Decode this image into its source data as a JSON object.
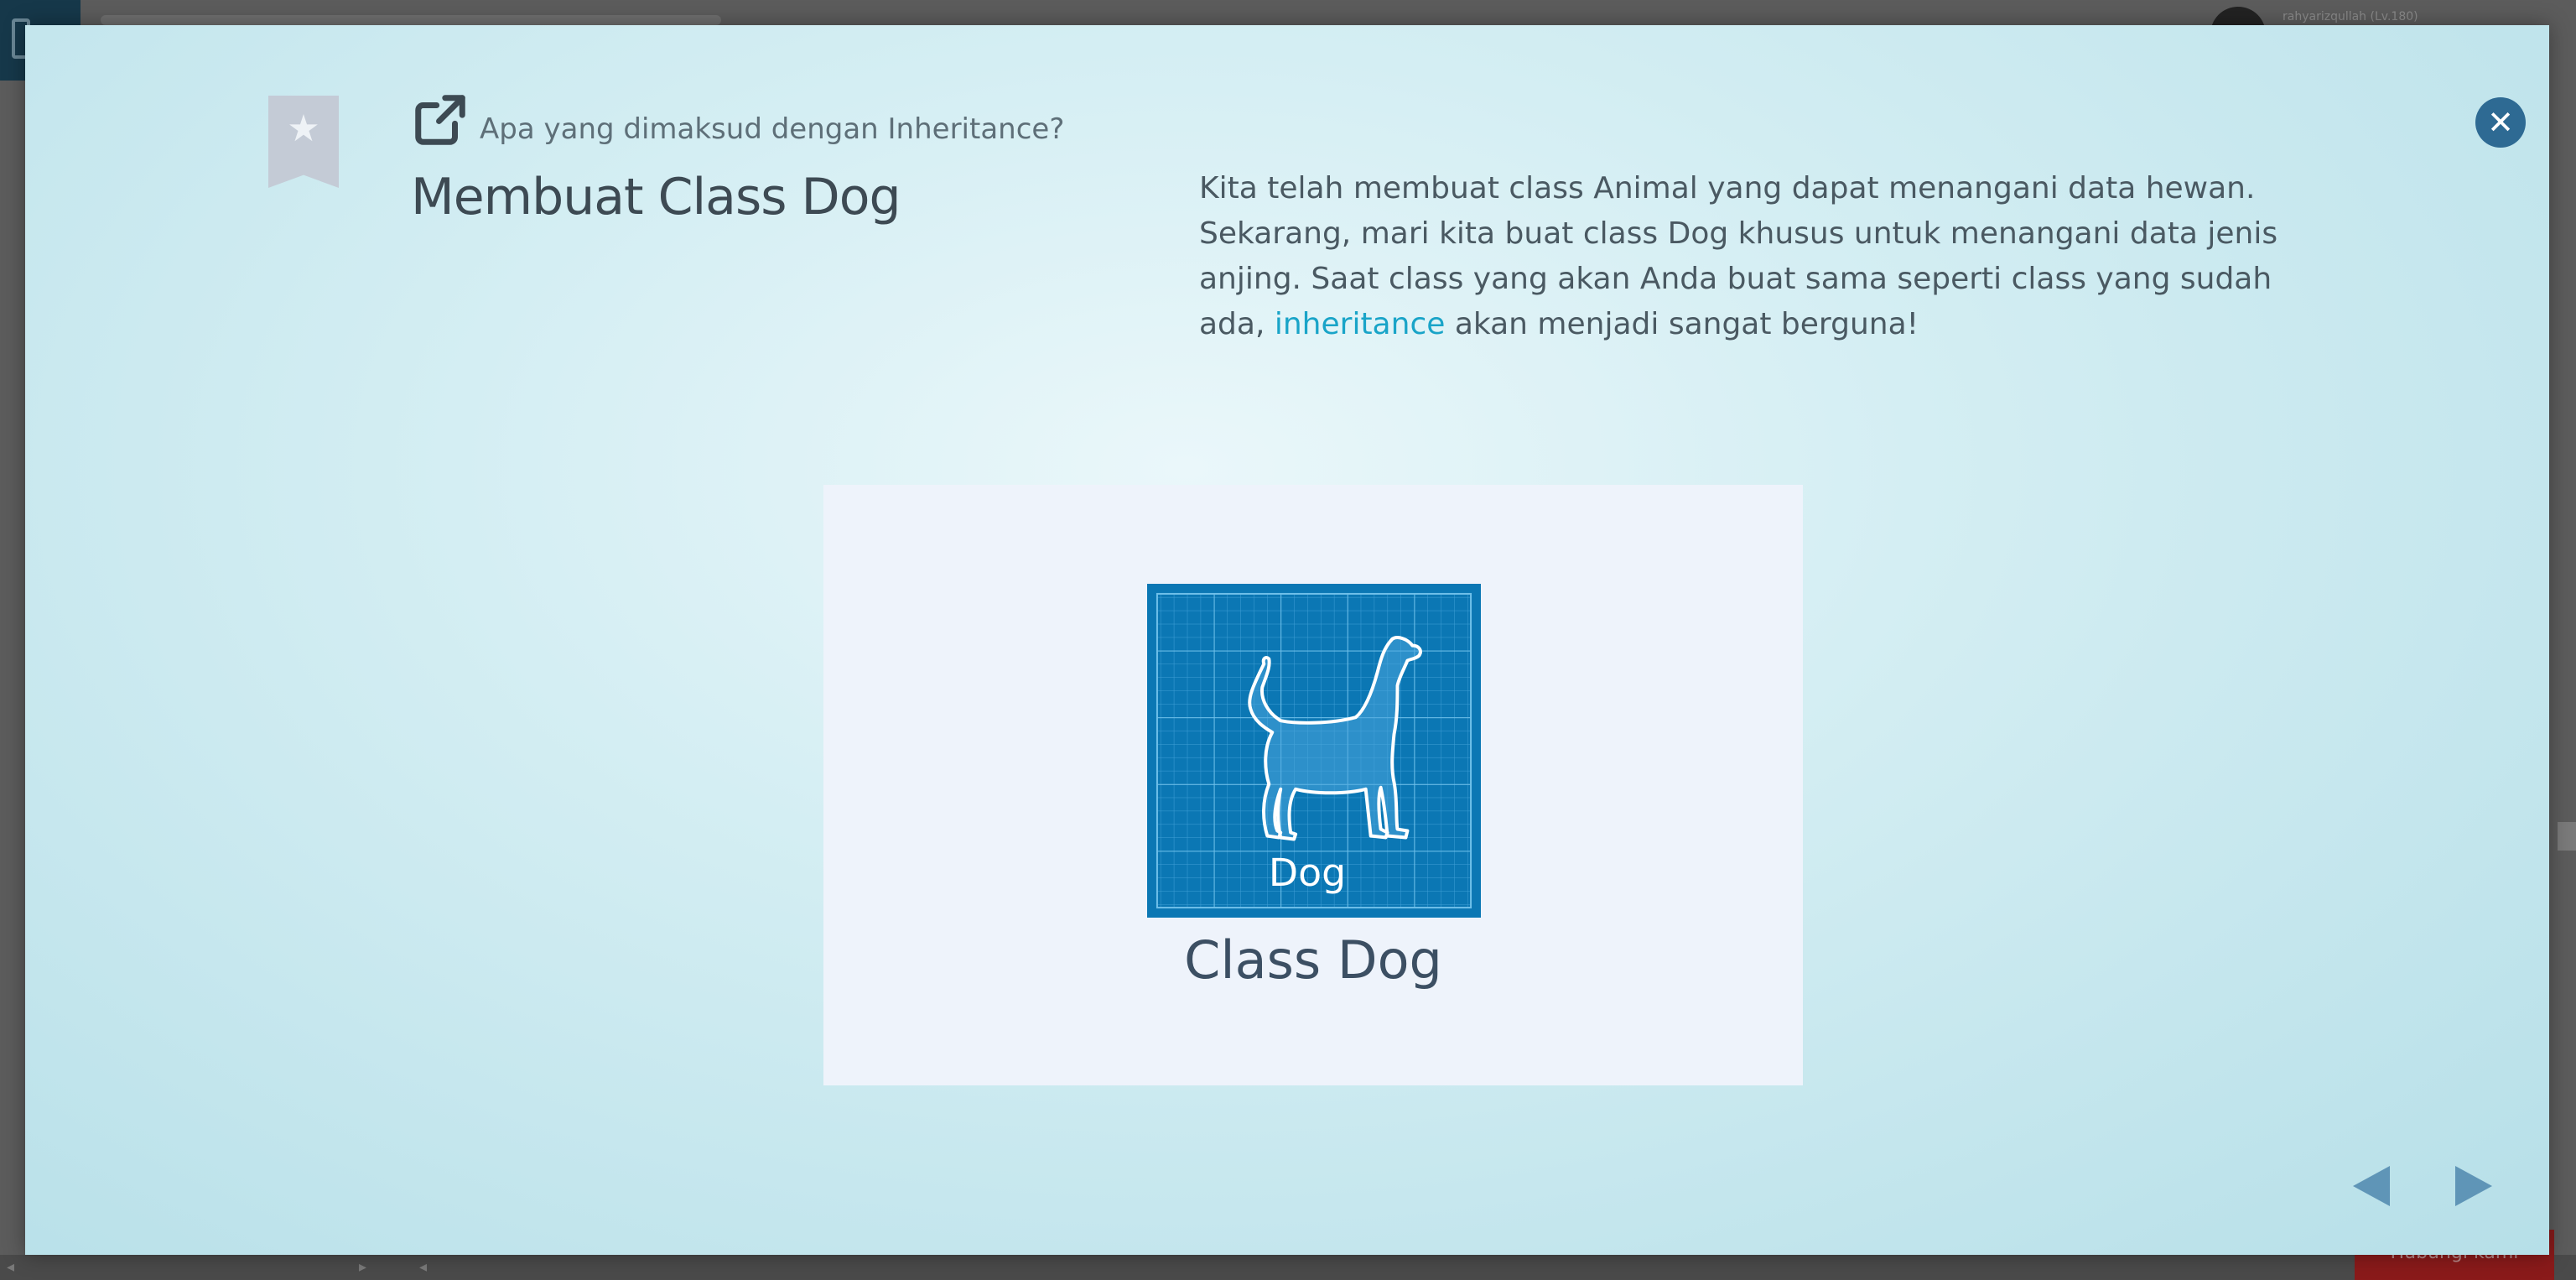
{
  "background": {
    "username": "rahyarizqullah (Lv.180)",
    "cta_label": "Hubungi kami"
  },
  "modal": {
    "subtitle": "Apa yang dimaksud dengan Inheritance?",
    "title": "Membuat Class Dog",
    "description_before": "Kita telah membuat class Animal yang dapat menangani data hewan. Sekarang, mari kita buat class Dog khusus untuk menangani data jenis anjing. Saat class yang akan Anda buat sama seperti class yang sudah ada, ",
    "description_link": "inheritance",
    "description_after": " akan menjadi sangat berguna!",
    "figure": {
      "icon_label": "Dog",
      "caption": "Class Dog"
    },
    "close_icon": "close-circle-icon",
    "prev_icon": "triangle-left-icon",
    "next_icon": "triangle-right-icon"
  },
  "colors": {
    "accent_link": "#19a4c8",
    "close_button": "#2e6a93",
    "blueprint": "#0b77b4",
    "nav_arrow": "#5f95b7"
  }
}
